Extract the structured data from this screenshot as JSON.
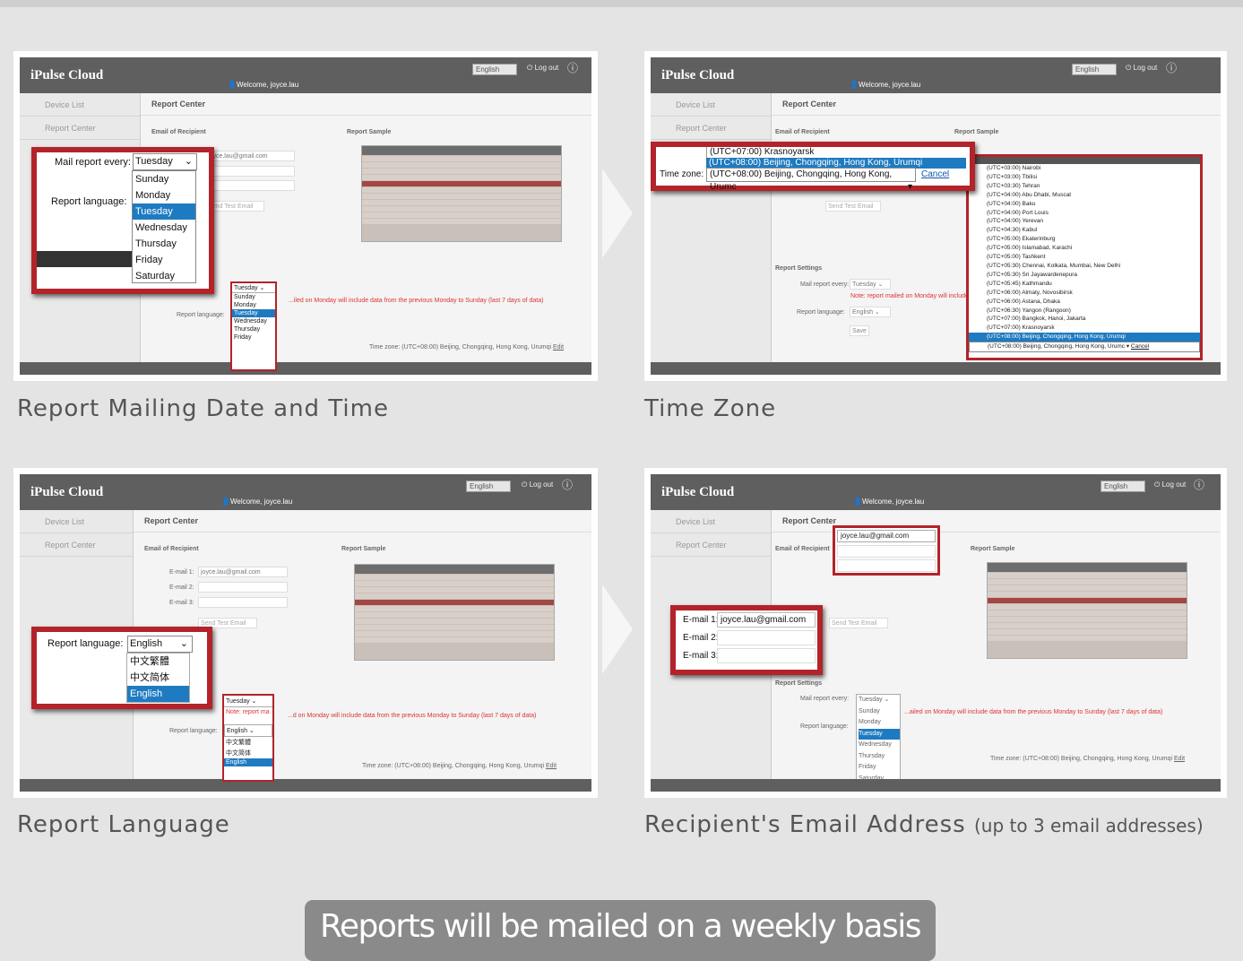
{
  "panels": [
    {
      "caption": "Report Mailing Date and Time"
    },
    {
      "caption": "Time Zone"
    },
    {
      "caption": "Report Language"
    },
    {
      "caption": "Recipient's Email Address",
      "caption_note": "(up to 3 email addresses)"
    }
  ],
  "app": {
    "logo": "iPulse Cloud",
    "language": "English",
    "logout": "Log out",
    "welcome": "Welcome, joyce.lau",
    "nav_device": "Device List",
    "nav_report": "Report Center",
    "page_title": "Report Center",
    "email_section": "Email of Recipient",
    "sample_section": "Report Sample",
    "email1_label": "E-mail 1:",
    "email2_label": "E-mail 2:",
    "email3_label": "E-mail 3:",
    "email1_value": "joyce.lau@gmail.com",
    "send_test": "Send Test Email",
    "report_settings": "Report Settings",
    "mail_every_label": "Mail report every:",
    "language_label": "Report language:",
    "note": "Note: report mailed on Monday will include data from the previous Monday to Sunday (last 7 days of data)",
    "timezone_line": "Time zone: (UTC+08:00) Beijing, Chongqing, Hong Kong, Urumqi",
    "edit": "Edit",
    "save": "Save",
    "sample_title": "Weekly System Health Check Report"
  },
  "panel1": {
    "label": "Mail report every:",
    "selected": "Tuesday",
    "days": [
      "Sunday",
      "Monday",
      "Tuesday",
      "Wednesday",
      "Thursday",
      "Friday",
      "Saturday"
    ],
    "lang_label": "Report language:"
  },
  "panel2": {
    "label": "Time zone:",
    "option_prev": "(UTC+07:00) Krasnoyarsk",
    "option_sel": "(UTC+08:00) Beijing, Chongqing, Hong Kong, Urumqi",
    "selected": "(UTC+08:00) Beijing, Chongqing, Hong Kong, Urumc",
    "cancel": "Cancel",
    "list": [
      "(UTC+03:00) Nairobi",
      "(UTC+03:00) Tbilisi",
      "(UTC+03:30) Tehran",
      "(UTC+04:00) Abu Dhabi, Muscat",
      "(UTC+04:00) Baku",
      "(UTC+04:00) Port Louis",
      "(UTC+04:00) Yerevan",
      "(UTC+04:30) Kabul",
      "(UTC+05:00) Ekaterinburg",
      "(UTC+05:00) Islamabad, Karachi",
      "(UTC+05:00) Tashkent",
      "(UTC+05:30) Chennai, Kolkata, Mumbai, New Delhi",
      "(UTC+05:30) Sri Jayawardenepura",
      "(UTC+05:45) Kathmandu",
      "(UTC+06:00) Almaty, Novosibirsk",
      "(UTC+06:00) Astana, Dhaka",
      "(UTC+06:30) Yangon (Rangoon)",
      "(UTC+07:00) Bangkok, Hanoi, Jakarta",
      "(UTC+07:00) Krasnoyarsk",
      "(UTC+08:00) Beijing, Chongqing, Hong Kong, Urumqi"
    ]
  },
  "panel3": {
    "label": "Report language:",
    "selected": "English",
    "options": [
      "中文繁體",
      "中文简体",
      "English"
    ]
  },
  "panel4": {
    "labels": [
      "E-mail 1:",
      "E-mail 2:",
      "E-mail 3:"
    ],
    "value1": "joyce.lau@gmail.com"
  },
  "banner": "Reports will be mailed on a weekly basis",
  "colors": {
    "accent": "#b3232a",
    "header": "#5f5f5f",
    "select": "#1f7bc1"
  }
}
